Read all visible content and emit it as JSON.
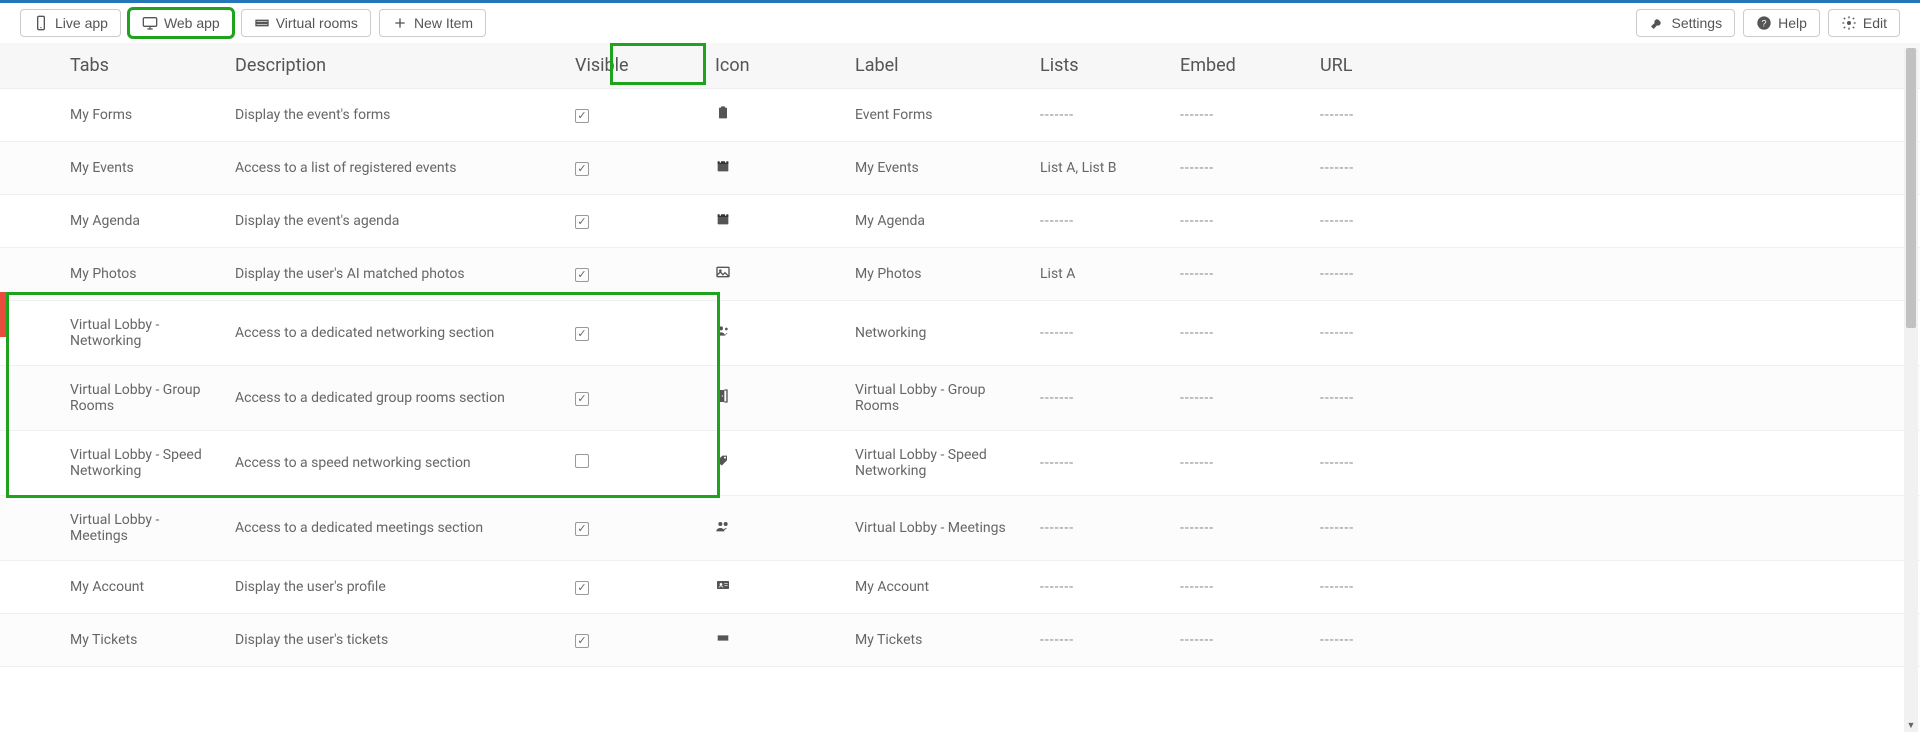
{
  "toolbar": {
    "left": [
      {
        "id": "live-app",
        "label": "Live app",
        "active": false,
        "icon": "phone"
      },
      {
        "id": "web-app",
        "label": "Web app",
        "active": true,
        "icon": "monitor"
      },
      {
        "id": "virtual-rooms",
        "label": "Virtual rooms",
        "active": false,
        "icon": "stack"
      }
    ],
    "new_item_label": "New Item",
    "right": [
      {
        "id": "settings",
        "label": "Settings",
        "icon": "wrench"
      },
      {
        "id": "help",
        "label": "Help",
        "icon": "question"
      },
      {
        "id": "edit",
        "label": "Edit",
        "icon": "gear"
      }
    ]
  },
  "columns": {
    "tabs": "Tabs",
    "description": "Description",
    "visible": "Visible",
    "icon": "Icon",
    "label": "Label",
    "lists": "Lists",
    "embed": "Embed",
    "url": "URL"
  },
  "rows": [
    {
      "tab": "My Forms",
      "desc": "Display the event's forms",
      "visible": true,
      "icon": "clipboard",
      "label": "Event Forms",
      "lists": "-------",
      "embed": "-------",
      "url": "-------"
    },
    {
      "tab": "My Events",
      "desc": "Access to a list of registered events",
      "visible": true,
      "icon": "calendar",
      "label": "My Events",
      "lists": "List A, List B",
      "embed": "-------",
      "url": "-------"
    },
    {
      "tab": "My Agenda",
      "desc": "Display the event's agenda",
      "visible": true,
      "icon": "calendar",
      "label": "My Agenda",
      "lists": "-------",
      "embed": "-------",
      "url": "-------"
    },
    {
      "tab": "My Photos",
      "desc": "Display the user's AI matched photos",
      "visible": true,
      "icon": "image",
      "label": "My Photos",
      "lists": "List A",
      "embed": "-------",
      "url": "-------"
    },
    {
      "tab": "Virtual Lobby - Networking",
      "desc": "Access to a dedicated networking section",
      "visible": true,
      "icon": "people",
      "label": "Networking",
      "lists": "-------",
      "embed": "-------",
      "url": "-------"
    },
    {
      "tab": "Virtual Lobby - Group Rooms",
      "desc": "Access to a dedicated group rooms section",
      "visible": true,
      "icon": "door",
      "label": "Virtual Lobby - Group Rooms",
      "lists": "-------",
      "embed": "-------",
      "url": "-------"
    },
    {
      "tab": "Virtual Lobby - Speed Networking",
      "desc": "Access to a speed networking section",
      "visible": false,
      "icon": "tags",
      "label": "Virtual Lobby - Speed Networking",
      "lists": "-------",
      "embed": "-------",
      "url": "-------"
    },
    {
      "tab": "Virtual Lobby - Meetings",
      "desc": "Access to a dedicated meetings section",
      "visible": true,
      "icon": "people2",
      "label": "Virtual Lobby - Meetings",
      "lists": "-------",
      "embed": "-------",
      "url": "-------"
    },
    {
      "tab": "My Account",
      "desc": "Display the user's profile",
      "visible": true,
      "icon": "idcard",
      "label": "My Account",
      "lists": "-------",
      "embed": "-------",
      "url": "-------"
    },
    {
      "tab": "My Tickets",
      "desc": "Display the user's tickets",
      "visible": true,
      "icon": "ticket",
      "label": "My Tickets",
      "lists": "-------",
      "embed": "-------",
      "url": "-------"
    }
  ],
  "icons": {
    "phone": "<svg viewBox='0 0 24 24'><rect x='7' y='2' width='10' height='20' rx='2' fill='none' stroke='#555' stroke-width='2'/><circle cx='12' cy='19' r='1' fill='#555'/></svg>",
    "monitor": "<svg viewBox='0 0 24 24'><rect x='2' y='4' width='20' height='13' rx='2' fill='none' stroke='#555' stroke-width='2'/><path d='M8 21h8M12 17v4' stroke='#555' stroke-width='2'/></svg>",
    "stack": "<svg viewBox='0 0 24 24'><path d='M3 8h18v3H3zM3 13h18v3H3z' fill='none' stroke='#555' stroke-width='2'/></svg>",
    "plus": "<svg viewBox='0 0 24 24'><path d='M12 5v14M5 12h14' stroke='#555' stroke-width='2'/></svg>",
    "wrench": "<svg viewBox='0 0 24 24'><path d='M14 7a4 4 0 0 0-5.6 5L3 17l4 4 5-5.4A4 4 0 0 0 17 10l-3-3z' fill='#555'/></svg>",
    "question": "<svg viewBox='0 0 24 24'><circle cx='12' cy='12' r='10' fill='#555'/><text x='12' y='17' text-anchor='middle' font-size='14' fill='#fff'>?</text></svg>",
    "gear": "<svg viewBox='0 0 24 24'><circle cx='12' cy='12' r='3' fill='#555'/><path d='M12 2v3M12 19v3M4.2 4.2l2.1 2.1M17.7 17.7l2.1 2.1M2 12h3M19 12h3M4.2 19.8l2.1-2.1M17.7 6.3l2.1-2.1' stroke='#555' stroke-width='2'/></svg>",
    "clipboard": "<svg viewBox='0 0 24 24'><rect x='6' y='4' width='12' height='16' rx='1' fill='#555'/><rect x='9' y='2' width='6' height='4' rx='1' fill='#555'/></svg>",
    "calendar": "<svg viewBox='0 0 24 24'><rect x='4' y='5' width='16' height='15' rx='1' fill='#555'/><rect x='4' y='5' width='16' height='4' fill='#333'/><path d='M8 3v4M16 3v4' stroke='#fff' stroke-width='2'/></svg>",
    "image": "<svg viewBox='0 0 24 24'><rect x='3' y='5' width='18' height='14' rx='1' fill='none' stroke='#555' stroke-width='2'/><circle cx='8' cy='10' r='2' fill='#555'/><path d='M3 17l5-5 4 4 3-3 6 6' fill='none' stroke='#555' stroke-width='2'/></svg>",
    "people": "<svg viewBox='0 0 24 24'><circle cx='9' cy='8' r='3' fill='#555'/><circle cx='17' cy='9' r='2' fill='#555'/><path d='M3 19c0-3 3-5 6-5s6 2 6 5M15 19c0-2 2-4 4-4' fill='#555'/></svg>",
    "door": "<svg viewBox='0 0 24 24'><rect x='6' y='3' width='8' height='18' fill='#555'/><path d='M14 3h4v18h-4' fill='none' stroke='#555' stroke-width='2'/><circle cx='11' cy='12' r='1' fill='#fff'/></svg>",
    "tags": "<svg viewBox='0 0 24 24'><path d='M3 12l8-8h7v7l-8 8-7-7z' fill='#555'/><circle cx='15' cy='7' r='1.5' fill='#fff'/></svg>",
    "people2": "<svg viewBox='0 0 24 24'><circle cx='8' cy='9' r='3' fill='#555'/><circle cx='16' cy='9' r='3' fill='#555'/><path d='M2 20c0-3 3-5 6-5s6 2 6 5M12 20c0-3 3-5 6-5' fill='#555'/></svg>",
    "idcard": "<svg viewBox='0 0 24 24'><rect x='3' y='6' width='18' height='12' rx='1' fill='#555'/><circle cx='9' cy='11' r='2' fill='#fff'/><path d='M6 16c0-1.5 1.5-2.5 3-2.5s3 1 3 2.5M14 10h5M14 13h5' stroke='#fff' stroke-width='1'/></svg>",
    "ticket": "<svg viewBox='0 0 24 24'><path d='M4 8h16v3a2 2 0 0 0 0 2v3H4v-3a2 2 0 0 0 0-2V8z' fill='#555'/></svg>"
  }
}
